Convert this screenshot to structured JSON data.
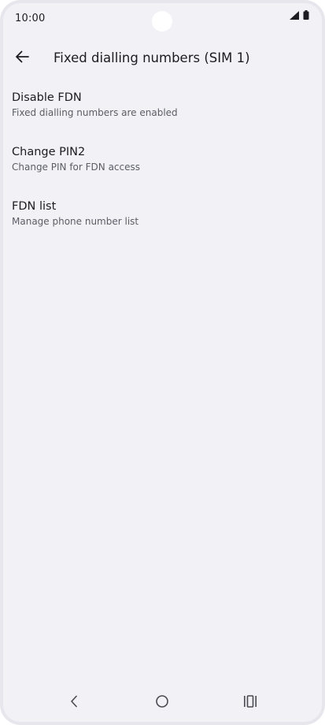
{
  "status_bar": {
    "time": "10:00",
    "signal_icon": "cellular-signal-icon",
    "battery_icon": "battery-icon"
  },
  "app_bar": {
    "back_icon": "arrow-back-icon",
    "title": "Fixed dialling numbers (SIM 1)"
  },
  "settings": {
    "items": [
      {
        "title": "Disable FDN",
        "subtitle": "Fixed dialling numbers are enabled"
      },
      {
        "title": "Change PIN2",
        "subtitle": "Change PIN for FDN access"
      },
      {
        "title": "FDN list",
        "subtitle": "Manage phone number list"
      }
    ]
  },
  "nav_bar": {
    "back_icon": "nav-back-icon",
    "home_icon": "nav-home-icon",
    "recents_icon": "nav-recents-icon"
  },
  "colors": {
    "screen_background": "#f1f1f6",
    "text_primary": "#1c1c22",
    "text_secondary": "#5d5d66",
    "frame": "#e6e6ec"
  }
}
